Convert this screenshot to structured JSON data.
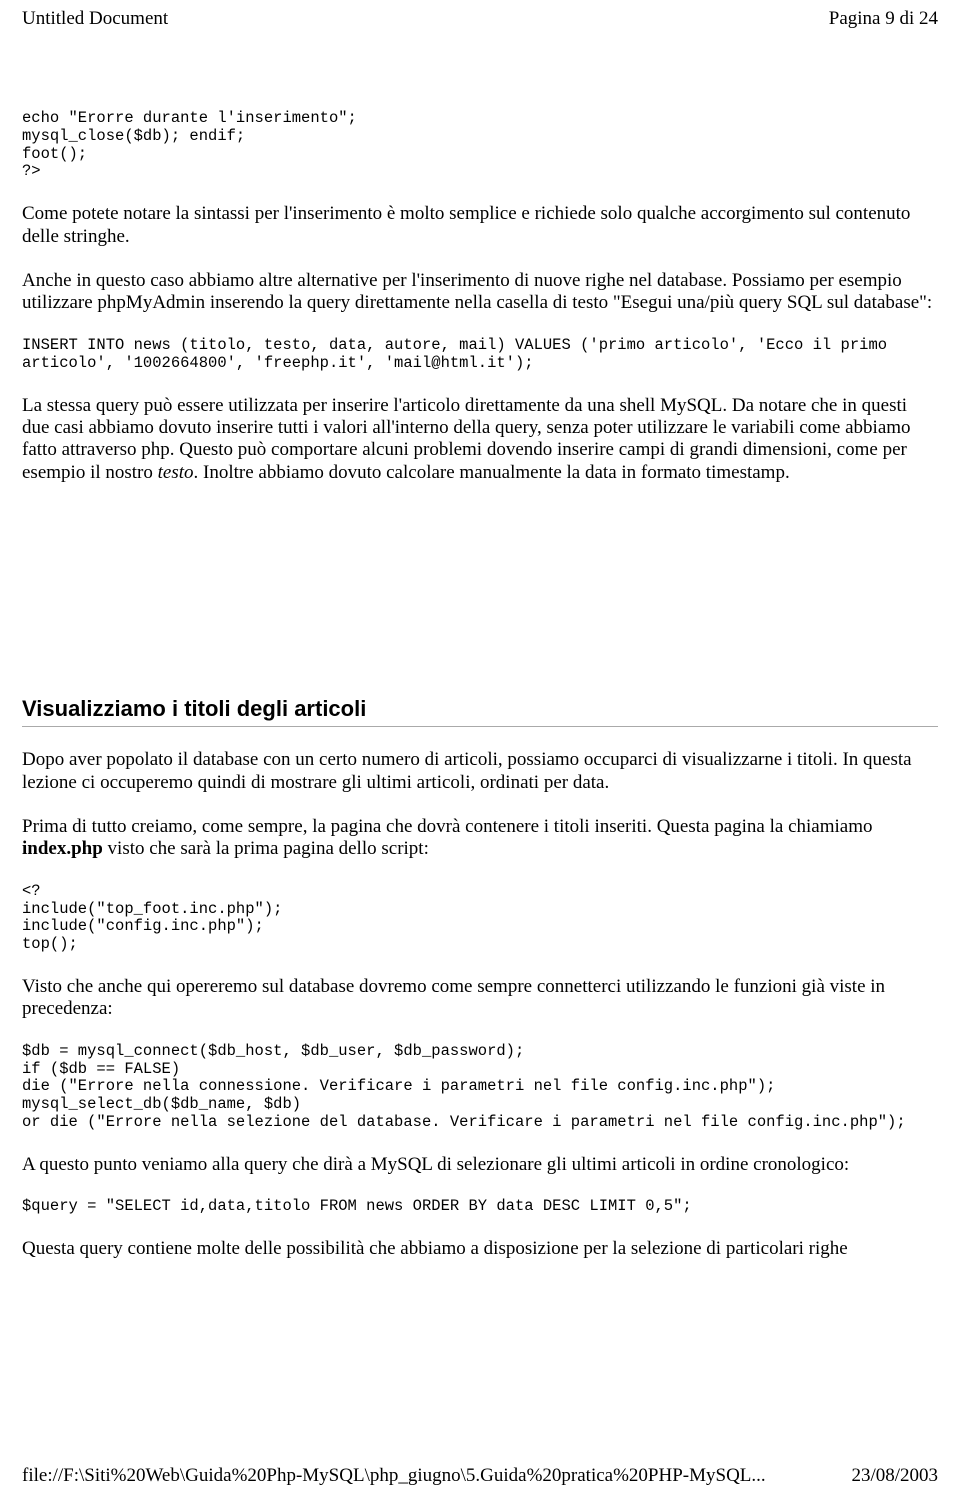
{
  "header": {
    "title": "Untitled Document",
    "page_label": "Pagina 9 di 24"
  },
  "code1": "echo \"Erorre durante l'inserimento\";\nmysql_close($db); endif;\nfoot();\n?>",
  "para1": "Come potete notare la sintassi per l'inserimento è molto semplice e richiede solo qualche accorgimento sul contenuto delle stringhe.",
  "para2": "Anche in questo caso abbiamo altre alternative per l'inserimento di nuove righe nel database. Possiamo per esempio utilizzare phpMyAdmin inserendo la query direttamente nella casella di testo \"Esegui una/più query SQL sul database\":",
  "code2": "INSERT INTO news (titolo, testo, data, autore, mail) VALUES ('primo articolo', 'Ecco il primo articolo', '1002664800', 'freephp.it', 'mail@html.it');",
  "para3_before": "La stessa query può essere utilizzata per inserire l'articolo direttamente da una shell MySQL.\nDa notare che in questi due casi abbiamo dovuto inserire tutti i valori all'interno della query, senza poter utilizzare le variabili come abbiamo fatto attraverso php. Questo può comportare alcuni problemi dovendo inserire campi di grandi dimensioni, come per esempio il nostro ",
  "para3_em": "testo",
  "para3_after": ". Inoltre abbiamo dovuto calcolare manualmente la data in formato timestamp.",
  "heading1": "Visualizziamo i titoli degli articoli",
  "para4": "Dopo aver popolato il database con un certo numero di articoli, possiamo occuparci di visualizzarne i titoli. In questa lezione ci occuperemo quindi di mostrare gli ultimi articoli, ordinati per data.",
  "para5_before": "Prima di tutto creiamo, come sempre, la pagina che dovrà contenere i titoli inseriti. Questa pagina la chiamiamo ",
  "para5_bold": "index.php",
  "para5_after": " visto che sarà la prima pagina dello script:",
  "code3": "<?\ninclude(\"top_foot.inc.php\");\ninclude(\"config.inc.php\");\ntop();",
  "para6": "Visto che anche qui opereremo sul database dovremo come sempre connetterci utilizzando le funzioni già viste in precedenza:",
  "code4": "$db = mysql_connect($db_host, $db_user, $db_password);\nif ($db == FALSE)\ndie (\"Errore nella connessione. Verificare i parametri nel file config.inc.php\");\nmysql_select_db($db_name, $db)\nor die (\"Errore nella selezione del database. Verificare i parametri nel file config.inc.php\");",
  "para7": "A questo punto veniamo alla query che dirà a MySQL di selezionare gli ultimi articoli in ordine cronologico:",
  "code5": "$query = \"SELECT id,data,titolo FROM news ORDER BY data DESC LIMIT 0,5\";",
  "para8": "Questa query contiene molte delle possibilità che abbiamo a disposizione per la selezione di particolari righe",
  "footer": {
    "path": "file://F:\\Siti%20Web\\Guida%20Php-MySQL\\php_giugno\\5.Guida%20pratica%20PHP-MySQL...",
    "date": "23/08/2003"
  }
}
